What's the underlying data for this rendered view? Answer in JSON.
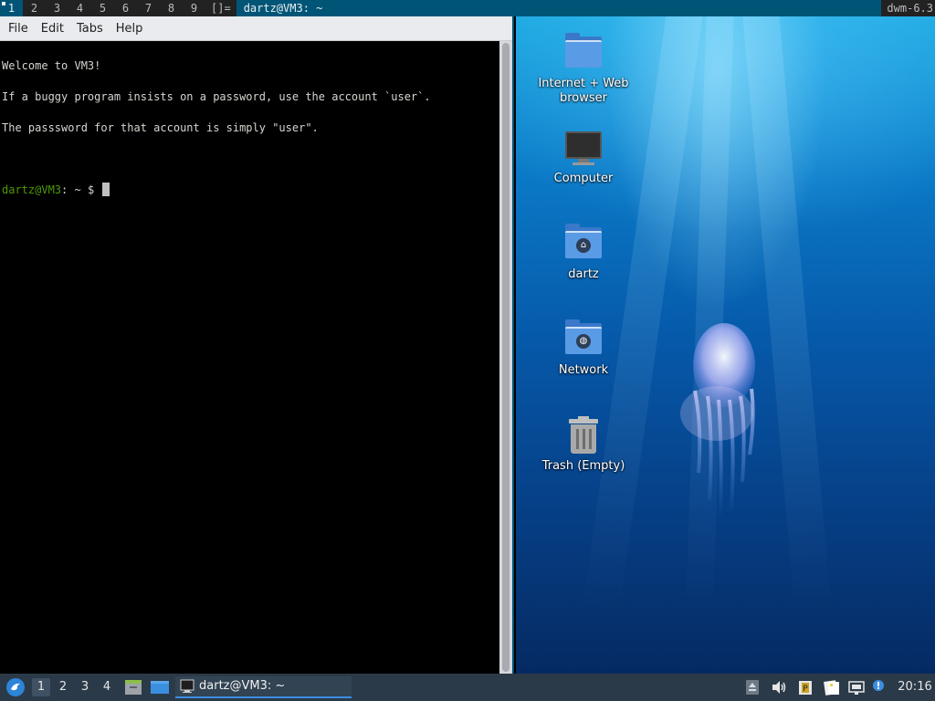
{
  "dwm_bar": {
    "tags": [
      "1",
      "2",
      "3",
      "4",
      "5",
      "6",
      "7",
      "8",
      "9"
    ],
    "layout_symbol": "[]=",
    "window_title": "dartz@VM3: ~",
    "status": "dwm-6.3"
  },
  "terminal": {
    "menu": [
      "File",
      "Edit",
      "Tabs",
      "Help"
    ],
    "lines": [
      "Welcome to VM3!",
      "If a buggy program insists on a password, use the account `user`.",
      "The passsword for that account is simply \"user\"."
    ],
    "prompt": {
      "user_host": "dartz@VM3",
      "path": ": ~",
      "symbol": " $ "
    }
  },
  "desktop": {
    "icons": [
      {
        "label": "Internet + Web browser",
        "icon": "folder-icon"
      },
      {
        "label": "Computer",
        "icon": "computer-icon"
      },
      {
        "label": "dartz",
        "icon": "home-folder-icon"
      },
      {
        "label": "Network",
        "icon": "network-folder-icon"
      },
      {
        "label": "Trash (Empty)",
        "icon": "trash-icon"
      }
    ]
  },
  "panel": {
    "workspaces": [
      "1",
      "2",
      "3",
      "4"
    ],
    "active_workspace": "1",
    "task_title": "dartz@VM3: ~",
    "clock": "20:16"
  },
  "colors": {
    "dwm_bg": "#222222",
    "dwm_selected": "#005577",
    "panel_bg": "#2b3a48",
    "prompt_green": "#4e9a06"
  }
}
